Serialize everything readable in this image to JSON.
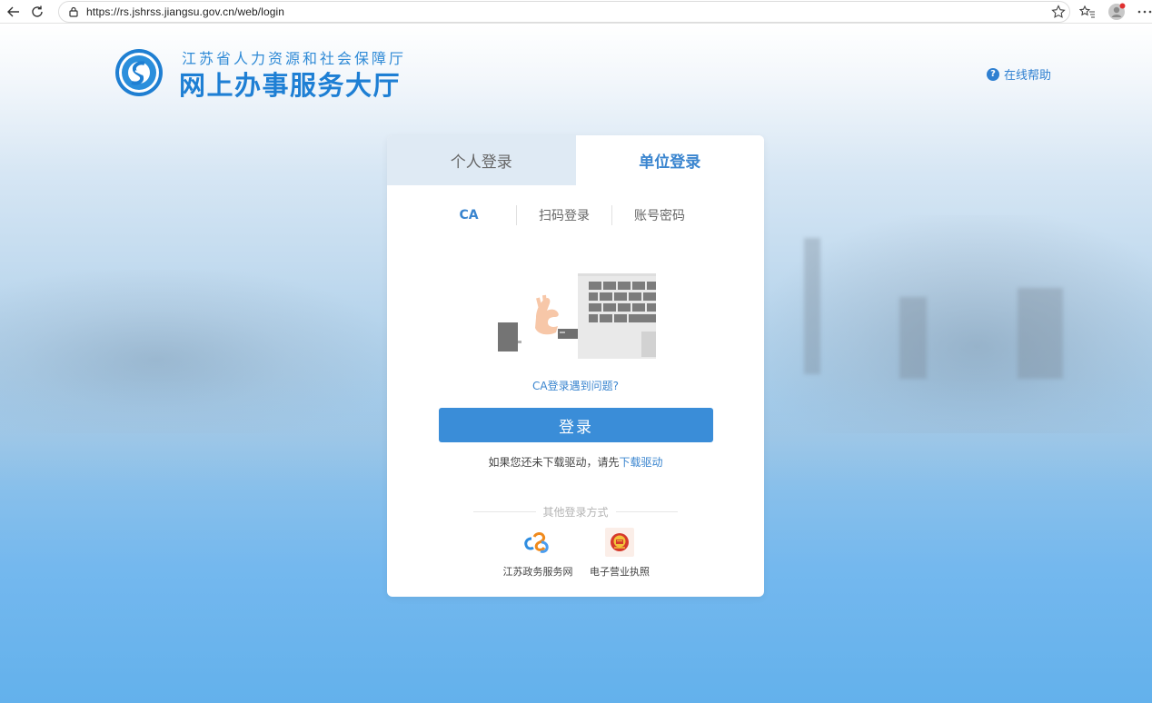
{
  "browser": {
    "url": "https://rs.jshrss.jiangsu.gov.cn/web/login",
    "icons": [
      "back-icon",
      "refresh-icon",
      "lock-icon",
      "star-icon",
      "favorites-icon",
      "profile-icon",
      "more-icon"
    ]
  },
  "header": {
    "subtitle": "江苏省人力资源和社会保障厅",
    "title": "网上办事服务大厅",
    "help_label": "在线帮助",
    "help_icon_glyph": "?"
  },
  "login": {
    "tabs": [
      {
        "label": "个人登录",
        "active": false
      },
      {
        "label": "单位登录",
        "active": true
      }
    ],
    "methods": [
      {
        "label": "CA",
        "active": true
      },
      {
        "label": "扫码登录",
        "active": false
      },
      {
        "label": "账号密码",
        "active": false
      }
    ],
    "ca_problem_link": "CA登录遇到问题?",
    "login_button": "登录",
    "driver_prefix": "如果您还未下载驱动，请先",
    "driver_link": "下载驱动",
    "other_methods_title": "其他登录方式",
    "other_methods": [
      {
        "label": "江苏政务服务网",
        "icon": "jiangsu-gov-service-icon"
      },
      {
        "label": "电子营业执照",
        "icon": "national-emblem-icon"
      }
    ]
  },
  "colors": {
    "accent": "#3a85cf",
    "button": "#3a8dd8",
    "title_blue": "#1e7fd4",
    "inactive_tab_bg": "#dfeaf4"
  }
}
